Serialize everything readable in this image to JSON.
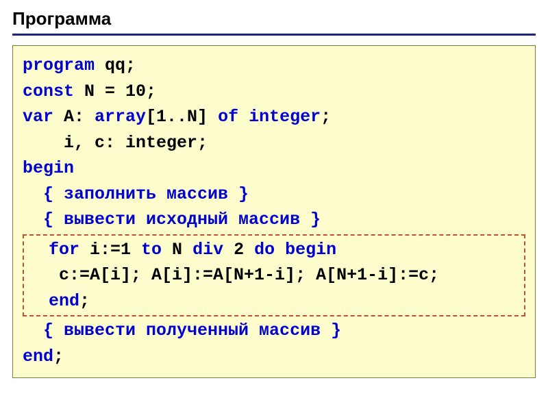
{
  "title": "Программа",
  "code": {
    "l1a": "program",
    "l1b": " qq;",
    "l2a": "const",
    "l2b": " N = 10;",
    "l3a": "var",
    "l3b": " A: ",
    "l3c": "array",
    "l3d": "[1..N] ",
    "l3e": "of integer",
    "l3f": ";",
    "l4": "    i, c: integer;",
    "l5": "begin",
    "l6": "  { заполнить массив }",
    "l7": "  { вывести исходный массив }",
    "l8a": "  for",
    "l8b": " i:=1 ",
    "l8c": "to",
    "l8d": " N ",
    "l8e": "div",
    "l8f": " 2 ",
    "l8g": "do begin",
    "l9": "   c:=A[i]; A[i]:=A[N+1-i]; A[N+1-i]:=c;",
    "l10": "  end",
    "l10b": ";",
    "l11": "  { вывести полученный массив }",
    "l12": "end",
    "l12b": ";"
  }
}
